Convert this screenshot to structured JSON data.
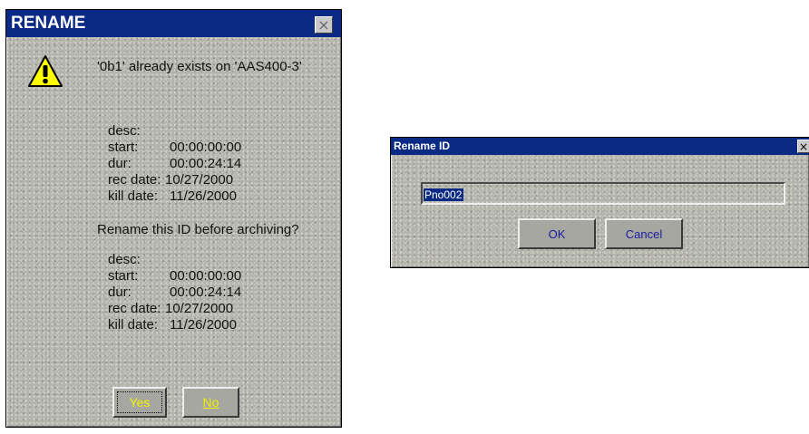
{
  "rename_dialog": {
    "title": "RENAME",
    "close_glyph": "×",
    "icon": "warning-triangle-icon",
    "message": "'0b1' already exists on 'AAS400-3'",
    "block1": [
      {
        "label": "desc:",
        "value": ""
      },
      {
        "label": "start:",
        "value": "00:00:00:00"
      },
      {
        "label": "dur:",
        "value": "00:00:24:14"
      },
      {
        "label": "rec date:",
        "value": "10/27/2000"
      },
      {
        "label": "kill date:",
        "value": "11/26/2000"
      }
    ],
    "question": "Rename this ID before archiving?",
    "block2": [
      {
        "label": "desc:",
        "value": ""
      },
      {
        "label": "start:",
        "value": "00:00:00:00"
      },
      {
        "label": "dur:",
        "value": "00:00:24:14"
      },
      {
        "label": "rec date:",
        "value": "10/27/2000"
      },
      {
        "label": "kill date:",
        "value": "11/26/2000"
      }
    ],
    "yes_label": "Yes",
    "no_label": "No"
  },
  "rename_id_dialog": {
    "title": "Rename ID",
    "close_glyph": "×",
    "input_value": "Pno002",
    "ok_label": "OK",
    "cancel_label": "Cancel"
  },
  "colors": {
    "titlebar": "#0a2a86",
    "button_text": "#1a1aa0",
    "yes_no_text": "#f2f200",
    "warning_fill": "#ffff00"
  }
}
